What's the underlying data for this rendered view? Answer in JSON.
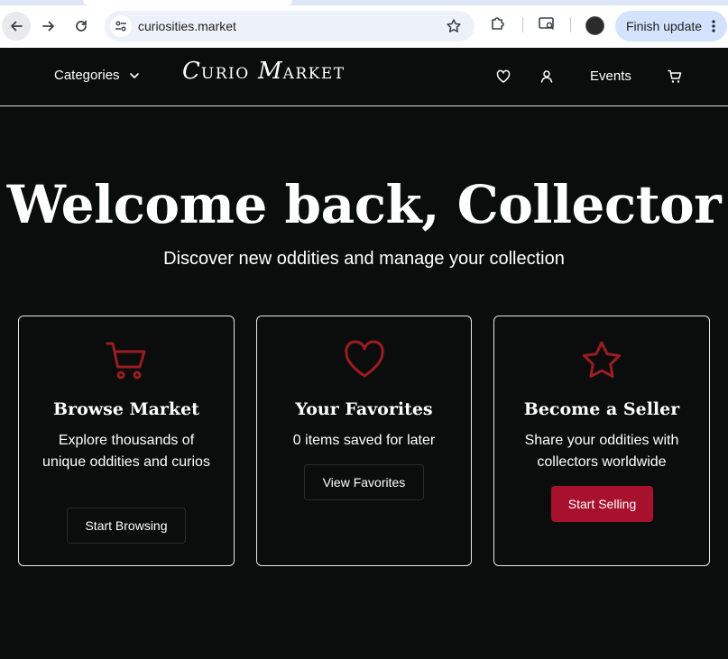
{
  "browser": {
    "url": "curiosities.market",
    "finish_update_label": "Finish update"
  },
  "header": {
    "categories_label": "Categories",
    "logo_first": "C",
    "logo_first_rest": "URIO",
    "logo_second": "M",
    "logo_second_rest": "ARKET",
    "events_label": "Events"
  },
  "hero": {
    "title": "Welcome back, Collector",
    "subtitle": "Discover new oddities and manage your collection"
  },
  "cards": [
    {
      "icon": "cart-icon",
      "title": "Browse Market",
      "description": "Explore thousands of unique oddities and curios",
      "button_label": "Start Browsing"
    },
    {
      "icon": "heart-icon",
      "title": "Your Favorites",
      "description": "0 items saved for later",
      "button_label": "View Favorites"
    },
    {
      "icon": "star-icon",
      "title": "Become a Seller",
      "description": "Share your oddities with collectors worldwide",
      "button_label": "Start Selling"
    }
  ],
  "colors": {
    "background": "#0b0c0c",
    "accent": "#a8112d",
    "icon_red": "#9b1c23",
    "browser_button": "#d3e3fd"
  }
}
